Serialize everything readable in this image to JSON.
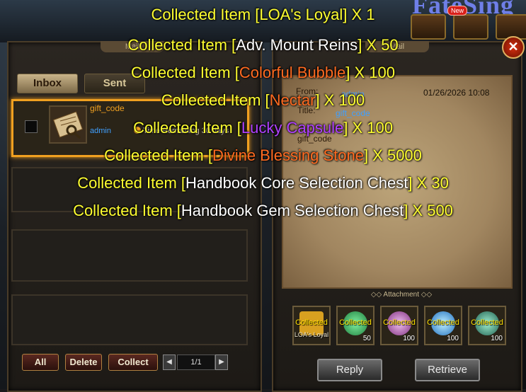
{
  "header": {
    "game_title": "FateSing",
    "new_badge": "New"
  },
  "panels": {
    "left_tab": "Mail",
    "right_tab": "Mail"
  },
  "tabs": [
    {
      "label": "Inbox"
    },
    {
      "label": "Sent"
    }
  ],
  "mail_list": [
    {
      "name": "gift_code",
      "sender": "admin",
      "time_remaining": "Time Remaining 30 days",
      "selected": true
    }
  ],
  "footer_buttons": {
    "all": "All",
    "delete": "Delete",
    "collect": "Collect"
  },
  "pager": {
    "text": "1/1"
  },
  "letter": {
    "from_label": "From:",
    "from_value": "admin",
    "title_label": "Title:",
    "title_value": "gift_code",
    "date": "01/26/2026 10:08",
    "body": "gift_code"
  },
  "attachment": {
    "label": "Attachment",
    "items": [
      {
        "status": "Collected",
        "sub": "LOA's Loyal",
        "qty": "",
        "color": "#d8a020"
      },
      {
        "status": "Collected",
        "sub": "",
        "qty": "50",
        "color": "#40c060"
      },
      {
        "status": "Collected",
        "sub": "",
        "qty": "100",
        "color": "#d060d0"
      },
      {
        "status": "Collected",
        "sub": "",
        "qty": "100",
        "color": "#40a0f0"
      },
      {
        "status": "Collected",
        "sub": "",
        "qty": "100",
        "color": "#30a080"
      }
    ]
  },
  "actions": {
    "reply": "Reply",
    "retrieve": "Retrieve"
  },
  "messages": [
    {
      "prefix": "Collected Item [",
      "item": "LOA's Loyal",
      "suffix": "] X 1",
      "item_color": "#ffff30"
    },
    {
      "prefix": "Collected Item [",
      "item": "Adv. Mount Reins",
      "suffix": "] X 50",
      "item_color": "#ffffff"
    },
    {
      "prefix": "Collected Item [",
      "item": "Colorful Bubble",
      "suffix": "] X 100",
      "item_color": "#ff6a20"
    },
    {
      "prefix": "Collected Item [",
      "item": "Nectar",
      "suffix": "] X 100",
      "item_color": "#ff6a20"
    },
    {
      "prefix": "Collected Item [",
      "item": "Lucky Capsule",
      "suffix": "] X 100",
      "item_color": "#b040ff"
    },
    {
      "prefix": "Collected Item [",
      "item": "Divine Blessing Stone",
      "suffix": "] X 5000",
      "item_color": "#ff6a20"
    },
    {
      "prefix": "Collected Item [",
      "item": "Handbook Core Selection Chest",
      "suffix": "] X 30",
      "item_color": "#ffffff"
    },
    {
      "prefix": "Collected Item [",
      "item": "Handbook Gem Selection Chest",
      "suffix": "] X 500",
      "item_color": "#ffffff"
    }
  ]
}
